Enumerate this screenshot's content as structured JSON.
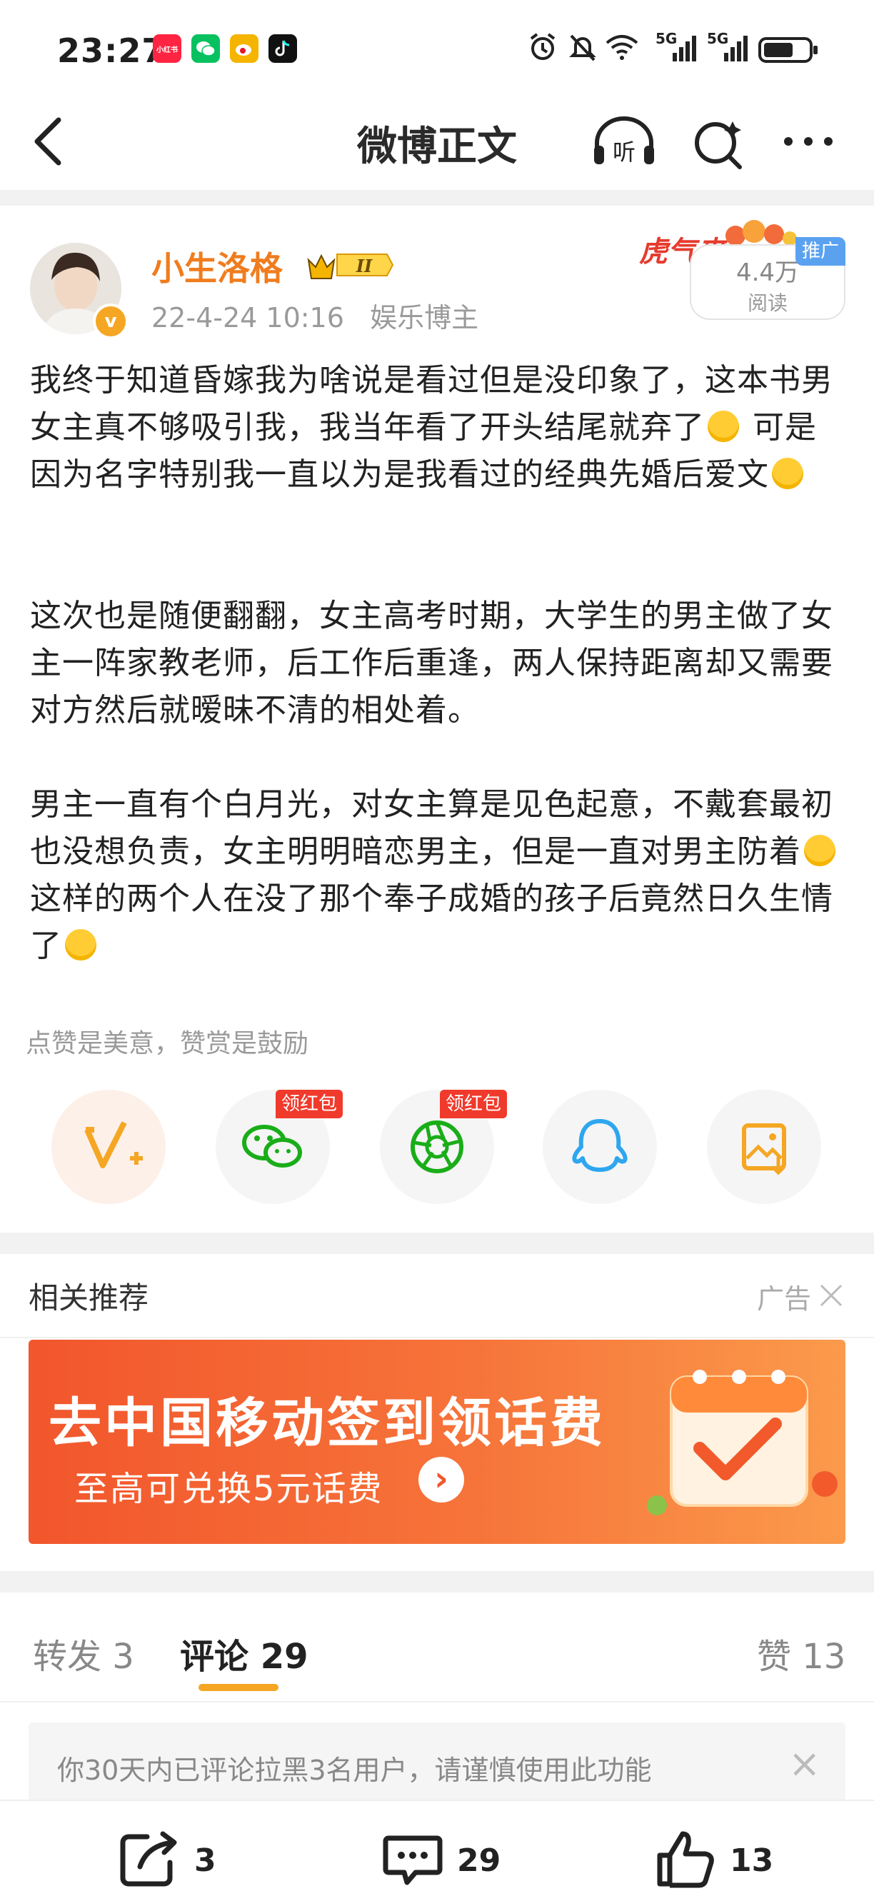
{
  "status_bar": {
    "time": "23:27",
    "apps": [
      {
        "name": "xiaohongshu-icon",
        "label": "小红书",
        "color": "#ff2442"
      },
      {
        "name": "wechat-icon",
        "label": "",
        "color": "#07c160"
      },
      {
        "name": "weibo-icon",
        "label": "",
        "color": "#f5b400"
      },
      {
        "name": "tiktok-icon",
        "label": "",
        "color": "#111111"
      }
    ],
    "net1": "5G",
    "net2": "5G",
    "wifi_label": "6"
  },
  "nav": {
    "title": "微博正文"
  },
  "post": {
    "username": "小生洛格",
    "level": "II",
    "timestamp": "22-4-24 10:16",
    "author_tag": "娱乐博主",
    "verified_badge": "v",
    "read_count": "4.4万",
    "read_label": "阅读",
    "promo_tag": "推广",
    "promo_art": "虎气来",
    "paragraphs": [
      "我终于知道昏嫁我为啥说是看过但是没印象了，这本书男女主真不够吸引我，我当年看了开头结尾就弃了",
      "这次也是随便翻翻，女主高考时期，大学生的男主做了女主一阵家教老师，后工作后重逢，两人保持距离却又需要对方然后就暧昧不清的相处着。",
      "男主一直有个白月光，对女主算是见色起意，不戴套最初也没想负责，女主明明暗恋男主，但是一直对男主防着"
    ],
    "para1_tail": " 可是因为名字特别我一直以为是我看过的经典先婚后爱文",
    "para3_mid": "这样的两个人在没了那个奉子成婚的孩子后竟然日久生情了"
  },
  "reward": {
    "encourage_text": "点赞是美意，赞赏是鼓励",
    "red_packet_tag_1": "领红包",
    "red_packet_tag_2": "领红包"
  },
  "related": {
    "title": "相关推荐",
    "ad_label": "广告",
    "ad_headline": "去中国移动签到领话费",
    "ad_sub": "至高可兑换5元话费"
  },
  "tabs": {
    "repost": "转发 3",
    "comment": "评论 29",
    "like": "赞 13"
  },
  "notice": {
    "text": "你30天内已评论拉黑3名用户，请谨慎使用此功能"
  },
  "bottom": {
    "repost_count": "3",
    "comment_count": "29",
    "like_count": "13"
  },
  "colors": {
    "accent_orange": "#f5a623",
    "username_orange": "#f07c1e",
    "ad_red": "#f2562c"
  }
}
